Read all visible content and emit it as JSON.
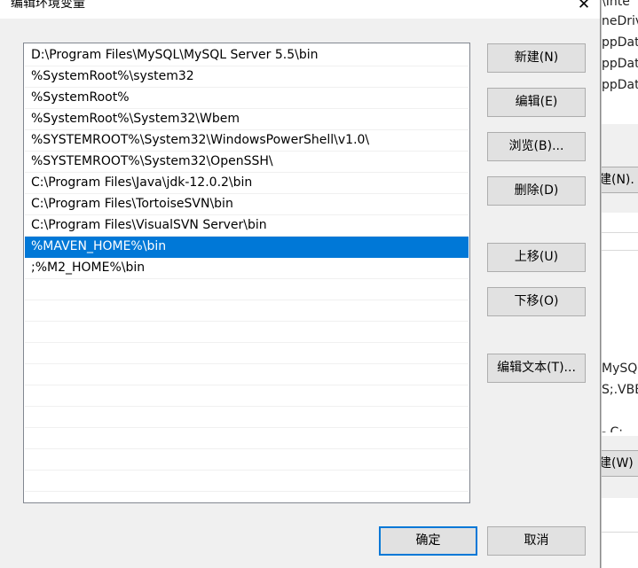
{
  "background_window": {
    "fragments": [
      "\\Inte",
      "neDriv",
      "ppDat",
      "ppDat",
      "ppDat",
      "MySQ",
      "S;.VBE",
      "- C:"
    ],
    "buttons": [
      "建(N).",
      "建(W)"
    ]
  },
  "dialog": {
    "title": "编辑环境变量",
    "close_symbol": "✕",
    "paths": [
      "D:\\Program Files\\MySQL\\MySQL Server 5.5\\bin",
      "%SystemRoot%\\system32",
      "%SystemRoot%",
      "%SystemRoot%\\System32\\Wbem",
      "%SYSTEMROOT%\\System32\\WindowsPowerShell\\v1.0\\",
      "%SYSTEMROOT%\\System32\\OpenSSH\\",
      "C:\\Program Files\\Java\\jdk-12.0.2\\bin",
      "C:\\Program Files\\TortoiseSVN\\bin",
      "C:\\Program Files\\VisualSVN Server\\bin",
      "%MAVEN_HOME%\\bin",
      ";%M2_HOME%\\bin"
    ],
    "selected_index": 9,
    "buttons": {
      "new": "新建(N)",
      "edit": "编辑(E)",
      "browse": "浏览(B)...",
      "delete": "删除(D)",
      "move_up": "上移(U)",
      "move_down": "下移(O)",
      "edit_text": "编辑文本(T)...",
      "ok": "确定",
      "cancel": "取消"
    },
    "colors": {
      "selection": "#0078d7",
      "default_border": "#0078d7"
    }
  }
}
